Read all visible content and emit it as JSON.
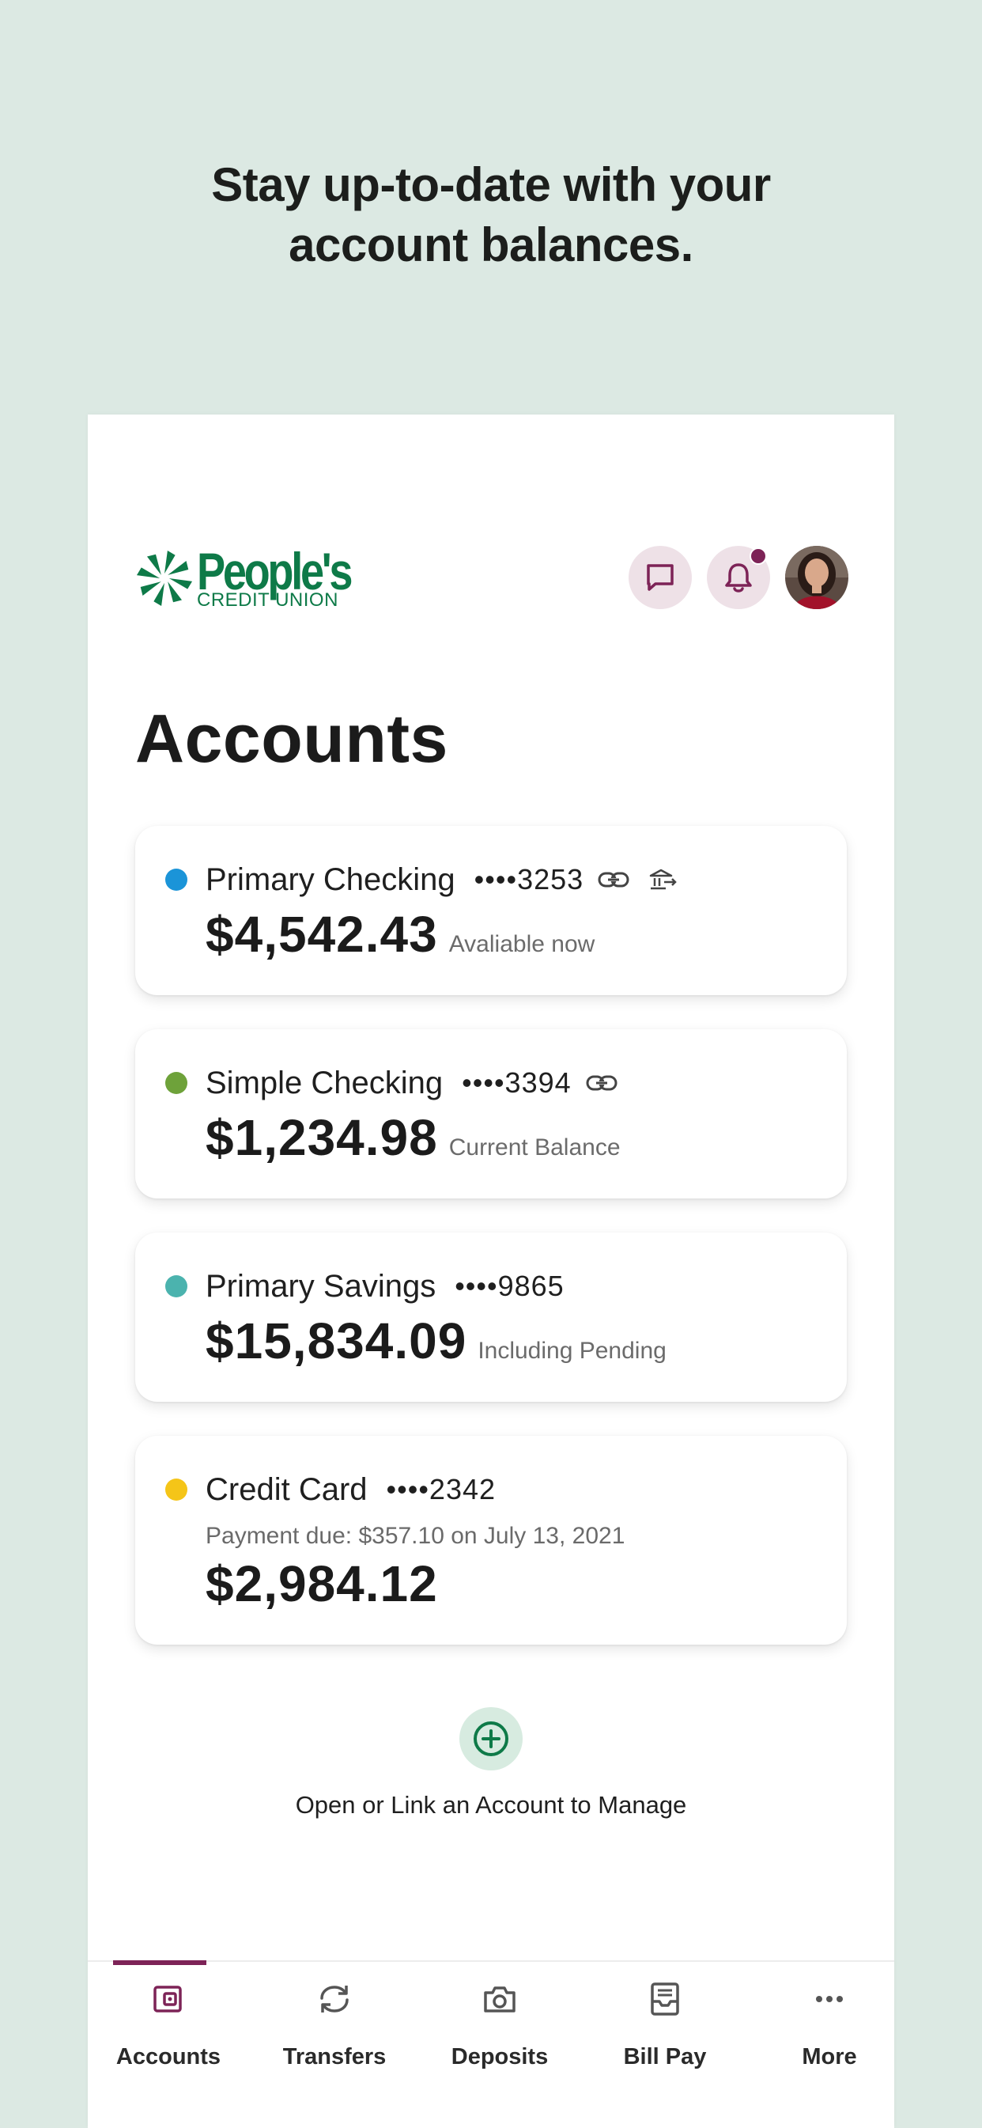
{
  "headline": {
    "line1": "Stay up-to-date with your",
    "line2": "account balances."
  },
  "brand": {
    "name": "People's",
    "sub": "CREDIT UNION",
    "color": "#0e7a48"
  },
  "header": {
    "chat_icon": "chat-bubble-icon",
    "bell_icon": "bell-icon",
    "notification_dot": true
  },
  "page": {
    "title": "Accounts"
  },
  "accounts": [
    {
      "name": "Primary Checking",
      "mask": "••••3253",
      "amount": "$4,542.43",
      "note": "Avaliable now",
      "dot_color": "#1b94d8",
      "icons": [
        "link-icon",
        "bank-transfer-icon"
      ]
    },
    {
      "name": "Simple Checking",
      "mask": "••••3394",
      "amount": "$1,234.98",
      "note": "Current Balance",
      "dot_color": "#6ea23a",
      "icons": [
        "link-icon"
      ]
    },
    {
      "name": "Primary Savings",
      "mask": "••••9865",
      "amount": "$15,834.09",
      "note": "Including Pending",
      "dot_color": "#4bb3ae",
      "icons": []
    },
    {
      "name": "Credit Card",
      "mask": "••••2342",
      "amount": "$2,984.12",
      "note": "",
      "due": "Payment due: $357.10 on July 13, 2021",
      "dot_color": "#f5c518",
      "icons": []
    }
  ],
  "add_account": {
    "label": "Open or Link an Account to Manage",
    "icon": "plus-circle-icon"
  },
  "tabs": [
    {
      "label": "Accounts",
      "icon": "wallet-icon",
      "active": true
    },
    {
      "label": "Transfers",
      "icon": "refresh-arrows-icon",
      "active": false
    },
    {
      "label": "Deposits",
      "icon": "camera-icon",
      "active": false
    },
    {
      "label": "Bill Pay",
      "icon": "inbox-bill-icon",
      "active": false
    },
    {
      "label": "More",
      "icon": "ellipsis-icon",
      "active": false
    }
  ],
  "colors": {
    "accent": "#7d2357",
    "background": "#dce9e3",
    "brand_green": "#0e7a48"
  }
}
